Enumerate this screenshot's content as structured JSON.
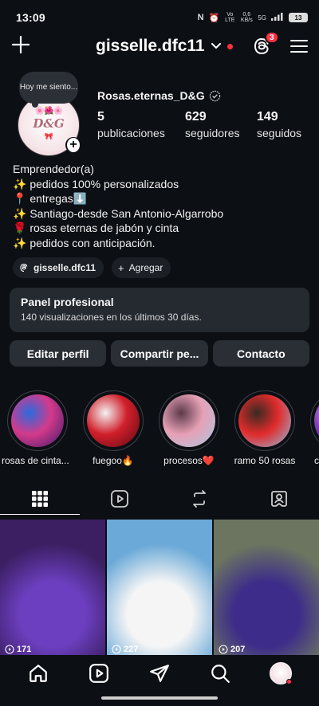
{
  "status_bar": {
    "time": "13:09",
    "net_speed_value": "0,6",
    "net_speed_unit": "KB/s",
    "network": "5G",
    "lte_label": "Vo LTE",
    "battery": "13"
  },
  "header": {
    "username": "gisselle.dfc11",
    "threads_badge": "3"
  },
  "profile": {
    "note": "Hoy me siento...",
    "display_name": "Rosas.eternas_D&G",
    "avatar_logo": "D&G",
    "stats": [
      {
        "value": "5",
        "label": "publicaciones"
      },
      {
        "value": "629",
        "label": "seguidores"
      },
      {
        "value": "149",
        "label": "seguidos"
      }
    ],
    "bio": [
      "Emprendedor(a)",
      "✨ pedidos 100% personalizados",
      "📍 entregas⬇️",
      "✨ Santiago-desde San Antonio-Algarrobo",
      "🌹 rosas eternas de jabón y cinta",
      "✨ pedidos con anticipación."
    ],
    "chips": {
      "threads_handle": "gisselle.dfc11",
      "add_label": "Agregar"
    }
  },
  "pro_panel": {
    "title": "Panel profesional",
    "subtitle": "140 visualizaciones en los últimos 30 días."
  },
  "actions": {
    "edit": "Editar perfil",
    "share": "Compartir pe...",
    "contact": "Contacto"
  },
  "highlights": [
    {
      "label": "rosas de cinta...",
      "colors": [
        "#3a1a6e",
        "#d43a8a",
        "#2a6adf"
      ]
    },
    {
      "label": "fuegoo🔥",
      "colors": [
        "#5a0a12",
        "#d11f2b",
        "#f2f2f2"
      ]
    },
    {
      "label": "procesos❤️",
      "colors": [
        "#a8c9e2",
        "#e7a0b5",
        "#5b3a4a"
      ]
    },
    {
      "label": "ramo 50 rosas",
      "colors": [
        "#8fbfe6",
        "#e12b2b",
        "#3a2a22"
      ]
    },
    {
      "label": "c",
      "colors": [
        "#2a1a4e",
        "#7a3ab0",
        "#c9a3e8"
      ]
    }
  ],
  "tabs": [
    "grid-icon",
    "reels-icon",
    "reposts-icon",
    "tagged-icon"
  ],
  "posts": [
    {
      "views": "171",
      "colors": [
        "#3c1f63",
        "#6c3fc0",
        "#e9c46a"
      ]
    },
    {
      "views": "227",
      "colors": [
        "#6aa9d8",
        "#f5f5f5",
        "#2b70b8"
      ]
    },
    {
      "views": "207",
      "colors": [
        "#6b7560",
        "#3d2c8a",
        "#4fc4b0"
      ]
    }
  ],
  "bottom_nav": [
    "home-icon",
    "reels-icon",
    "direct-icon",
    "search-icon",
    "profile-avatar"
  ]
}
